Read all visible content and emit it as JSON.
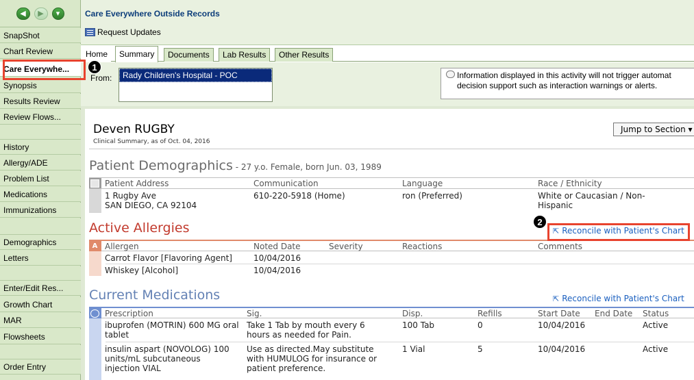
{
  "sidebar": {
    "items": [
      {
        "label": "SnapShot"
      },
      {
        "label": "Chart Review"
      },
      {
        "label": "Care Everywhe..."
      },
      {
        "label": "Synopsis"
      },
      {
        "label": "Results Review"
      },
      {
        "label": "Review Flows..."
      },
      {
        "label": "History"
      },
      {
        "label": "Allergy/ADE"
      },
      {
        "label": "Problem List"
      },
      {
        "label": "Medications"
      },
      {
        "label": "Immunizations"
      },
      {
        "label": "Demographics"
      },
      {
        "label": "Letters"
      },
      {
        "label": "Enter/Edit Res..."
      },
      {
        "label": "Growth Chart"
      },
      {
        "label": "MAR"
      },
      {
        "label": "Flowsheets"
      },
      {
        "label": "Order Entry"
      }
    ]
  },
  "header": {
    "title": "Care Everywhere Outside Records",
    "request_updates": "Request Updates"
  },
  "tabs": [
    {
      "label": "Home"
    },
    {
      "label": "Summary"
    },
    {
      "label": "Documents"
    },
    {
      "label": "Lab Results"
    },
    {
      "label": "Other Results"
    }
  ],
  "from": {
    "label": "From:",
    "selected": "Rady Children's Hospital - POC"
  },
  "info": {
    "text": "Information displayed in this activity will not trigger automat\ndecision support such as interaction warnings or alerts."
  },
  "patient": {
    "name": "Deven RUGBY",
    "subtitle": "Clinical Summary, as of Oct. 04, 2016",
    "jump_label": "Jump to Section"
  },
  "demographics": {
    "title": "Patient Demographics",
    "subtitle": " - 27 y.o. Female, born Jun. 03, 1989",
    "headers": [
      "Patient Address",
      "Communication",
      "Language",
      "Race / Ethnicity"
    ],
    "address": "1 Rugby Ave\nSAN DIEGO, CA 92104",
    "communication": "610-220-5918 (Home)",
    "language": "ron (Preferred)",
    "race": "White or Caucasian / Non-\n    Hispanic"
  },
  "allergies": {
    "title": "Active Allergies",
    "reconcile": "Reconcile with Patient's Chart",
    "headers": [
      "Allergen",
      "Noted Date",
      "Severity",
      "Reactions",
      "Comments"
    ],
    "rows": [
      {
        "allergen": "Carrot Flavor [Flavoring Agent]",
        "date": "10/04/2016"
      },
      {
        "allergen": "Whiskey [Alcohol]",
        "date": "10/04/2016"
      }
    ]
  },
  "medications": {
    "title": "Current Medications",
    "reconcile": "Reconcile with Patient's Chart",
    "headers": [
      "Prescription",
      "Sig.",
      "Disp.",
      "Refills",
      "Start Date",
      "End Date",
      "Status"
    ],
    "rows": [
      {
        "rx": "ibuprofen (MOTRIN) 600 MG oral\n    tablet",
        "sig": "Take 1 Tab by mouth every 6\n    hours as needed for Pain.",
        "disp": "100 Tab",
        "refills": "0",
        "start": "10/04/2016",
        "end": "",
        "status": "Active"
      },
      {
        "rx": "insulin aspart (NOVOLOG) 100\n    units/mL subcutaneous\n    injection VIAL",
        "sig": "Use as directed.May substitute\n    with HUMULOG for insurance or\n    patient preference.",
        "disp": "1 Vial",
        "refills": "5",
        "start": "10/04/2016",
        "end": "",
        "status": "Active"
      }
    ]
  },
  "callouts": {
    "one": "1",
    "two": "2"
  },
  "colors": {
    "sidebar_bg": "#d9e8c9",
    "allergy_accent": "#c23a2d",
    "med_accent": "#6381b4",
    "highlight": "#e8432e",
    "link": "#1a5fbf"
  }
}
